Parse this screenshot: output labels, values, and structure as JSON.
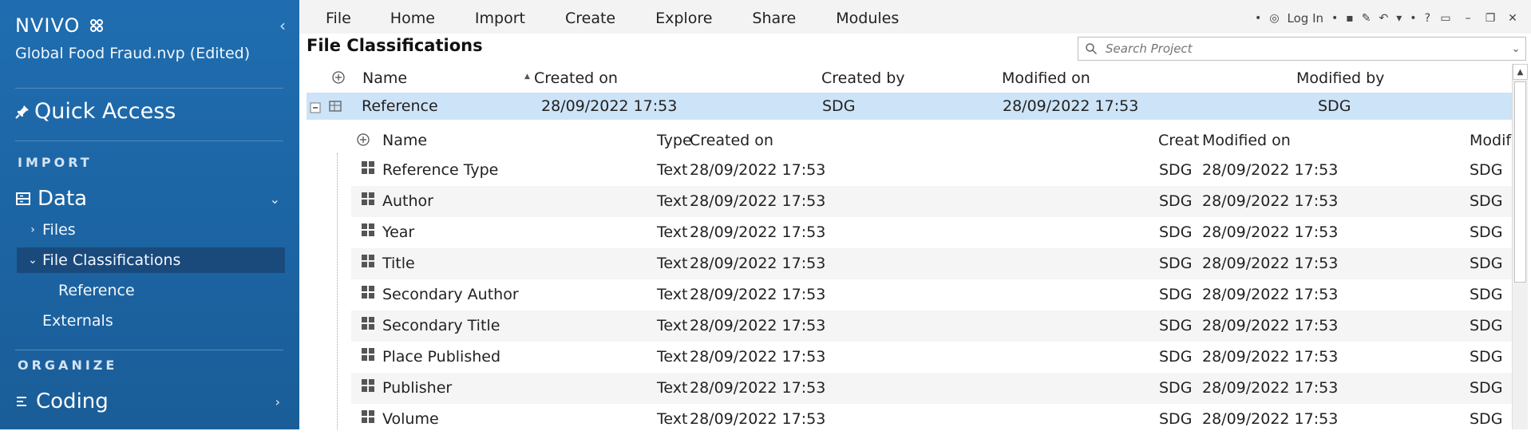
{
  "app": {
    "logo_text": "NVIVO",
    "project": "Global Food Fraud.nvp (Edited)"
  },
  "sidebar": {
    "quick_access": "Quick Access",
    "sections": [
      {
        "label": "IMPORT"
      },
      {
        "label": "ORGANIZE"
      }
    ],
    "data_label": "Data",
    "items": [
      {
        "label": "Files"
      },
      {
        "label": "File Classifications"
      },
      {
        "label": "Reference"
      },
      {
        "label": "Externals"
      }
    ],
    "coding_label": "Coding"
  },
  "ribbon": {
    "menu": [
      "File",
      "Home",
      "Import",
      "Create",
      "Explore",
      "Share",
      "Modules"
    ],
    "login": "Log In",
    "help": "?"
  },
  "view": {
    "title": "File Classifications"
  },
  "search": {
    "placeholder": "Search Project"
  },
  "grid": {
    "columns": [
      "Name",
      "Created on",
      "Created by",
      "Modified on",
      "Modified by"
    ],
    "rows": [
      {
        "name": "Reference",
        "created_on": "28/09/2022 17:53",
        "created_by": "SDG",
        "modified_on": "28/09/2022 17:53",
        "modified_by": "SDG"
      }
    ]
  },
  "subgrid": {
    "columns": [
      "Name",
      "Type",
      "Created on",
      "Creat",
      "Modified on",
      "Modif"
    ],
    "rows": [
      {
        "name": "Reference Type",
        "type": "Text",
        "created_on": "28/09/2022 17:53",
        "created_by": "SDG",
        "modified_on": "28/09/2022 17:53",
        "modified_by": "SDG"
      },
      {
        "name": "Author",
        "type": "Text",
        "created_on": "28/09/2022 17:53",
        "created_by": "SDG",
        "modified_on": "28/09/2022 17:53",
        "modified_by": "SDG"
      },
      {
        "name": "Year",
        "type": "Text",
        "created_on": "28/09/2022 17:53",
        "created_by": "SDG",
        "modified_on": "28/09/2022 17:53",
        "modified_by": "SDG"
      },
      {
        "name": "Title",
        "type": "Text",
        "created_on": "28/09/2022 17:53",
        "created_by": "SDG",
        "modified_on": "28/09/2022 17:53",
        "modified_by": "SDG"
      },
      {
        "name": "Secondary Author",
        "type": "Text",
        "created_on": "28/09/2022 17:53",
        "created_by": "SDG",
        "modified_on": "28/09/2022 17:53",
        "modified_by": "SDG"
      },
      {
        "name": "Secondary Title",
        "type": "Text",
        "created_on": "28/09/2022 17:53",
        "created_by": "SDG",
        "modified_on": "28/09/2022 17:53",
        "modified_by": "SDG"
      },
      {
        "name": "Place Published",
        "type": "Text",
        "created_on": "28/09/2022 17:53",
        "created_by": "SDG",
        "modified_on": "28/09/2022 17:53",
        "modified_by": "SDG"
      },
      {
        "name": "Publisher",
        "type": "Text",
        "created_on": "28/09/2022 17:53",
        "created_by": "SDG",
        "modified_on": "28/09/2022 17:53",
        "modified_by": "SDG"
      },
      {
        "name": "Volume",
        "type": "Text",
        "created_on": "28/09/2022 17:53",
        "created_by": "SDG",
        "modified_on": "28/09/2022 17:53",
        "modified_by": "SDG"
      }
    ]
  },
  "colors": {
    "sidebar": "#1f6db0",
    "selection": "#cde3f7",
    "active_nav": "#1a4a7c"
  }
}
